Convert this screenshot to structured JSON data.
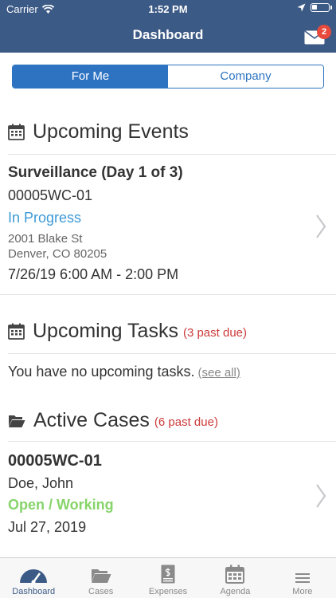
{
  "status_bar": {
    "carrier": "Carrier",
    "time": "1:52 PM"
  },
  "nav": {
    "title": "Dashboard",
    "mail_badge": "2"
  },
  "segment": {
    "options": [
      "For Me",
      "Company"
    ],
    "selected": "For Me"
  },
  "events": {
    "title": "Upcoming Events",
    "item": {
      "name": "Surveillance (Day 1 of 3)",
      "case_number": "00005WC-01",
      "status": "In Progress",
      "address_line1": "2001 Blake St",
      "address_line2": "Denver, CO 80205",
      "time_range": "7/26/19 6:00 AM - 2:00 PM"
    }
  },
  "tasks": {
    "title": "Upcoming Tasks",
    "past_due": "(3 past due)",
    "empty_text": "You have no upcoming tasks.",
    "see_all": "(see all)"
  },
  "cases": {
    "title": "Active Cases",
    "past_due": "(6 past due)",
    "item": {
      "case_number": "00005WC-01",
      "client": "Doe, John",
      "status": "Open / Working",
      "date": "Jul 27, 2019"
    }
  },
  "tabbar": {
    "items": [
      {
        "label": "Dashboard",
        "icon": "gauge-icon"
      },
      {
        "label": "Cases",
        "icon": "folder-icon"
      },
      {
        "label": "Expenses",
        "icon": "receipt-icon"
      },
      {
        "label": "Agenda",
        "icon": "calendar-icon"
      },
      {
        "label": "More",
        "icon": "menu-icon"
      }
    ],
    "active": "Dashboard"
  },
  "colors": {
    "nav_bg": "#3c5a86",
    "accent_blue": "#2d73c2",
    "status_blue": "#3d9ad6",
    "status_green": "#86d46a",
    "past_due_red": "#cc3b3b",
    "badge_red": "#e74a3c"
  }
}
